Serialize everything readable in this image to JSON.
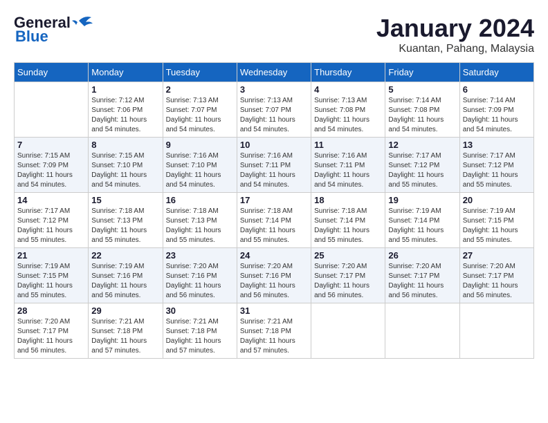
{
  "header": {
    "logo_general": "General",
    "logo_blue": "Blue",
    "month": "January 2024",
    "location": "Kuantan, Pahang, Malaysia"
  },
  "weekdays": [
    "Sunday",
    "Monday",
    "Tuesday",
    "Wednesday",
    "Thursday",
    "Friday",
    "Saturday"
  ],
  "weeks": [
    [
      {
        "day": "",
        "sunrise": "",
        "sunset": "",
        "daylight": ""
      },
      {
        "day": "1",
        "sunrise": "Sunrise: 7:12 AM",
        "sunset": "Sunset: 7:06 PM",
        "daylight": "Daylight: 11 hours and 54 minutes."
      },
      {
        "day": "2",
        "sunrise": "Sunrise: 7:13 AM",
        "sunset": "Sunset: 7:07 PM",
        "daylight": "Daylight: 11 hours and 54 minutes."
      },
      {
        "day": "3",
        "sunrise": "Sunrise: 7:13 AM",
        "sunset": "Sunset: 7:07 PM",
        "daylight": "Daylight: 11 hours and 54 minutes."
      },
      {
        "day": "4",
        "sunrise": "Sunrise: 7:13 AM",
        "sunset": "Sunset: 7:08 PM",
        "daylight": "Daylight: 11 hours and 54 minutes."
      },
      {
        "day": "5",
        "sunrise": "Sunrise: 7:14 AM",
        "sunset": "Sunset: 7:08 PM",
        "daylight": "Daylight: 11 hours and 54 minutes."
      },
      {
        "day": "6",
        "sunrise": "Sunrise: 7:14 AM",
        "sunset": "Sunset: 7:09 PM",
        "daylight": "Daylight: 11 hours and 54 minutes."
      }
    ],
    [
      {
        "day": "7",
        "sunrise": "Sunrise: 7:15 AM",
        "sunset": "Sunset: 7:09 PM",
        "daylight": "Daylight: 11 hours and 54 minutes."
      },
      {
        "day": "8",
        "sunrise": "Sunrise: 7:15 AM",
        "sunset": "Sunset: 7:10 PM",
        "daylight": "Daylight: 11 hours and 54 minutes."
      },
      {
        "day": "9",
        "sunrise": "Sunrise: 7:16 AM",
        "sunset": "Sunset: 7:10 PM",
        "daylight": "Daylight: 11 hours and 54 minutes."
      },
      {
        "day": "10",
        "sunrise": "Sunrise: 7:16 AM",
        "sunset": "Sunset: 7:11 PM",
        "daylight": "Daylight: 11 hours and 54 minutes."
      },
      {
        "day": "11",
        "sunrise": "Sunrise: 7:16 AM",
        "sunset": "Sunset: 7:11 PM",
        "daylight": "Daylight: 11 hours and 54 minutes."
      },
      {
        "day": "12",
        "sunrise": "Sunrise: 7:17 AM",
        "sunset": "Sunset: 7:12 PM",
        "daylight": "Daylight: 11 hours and 55 minutes."
      },
      {
        "day": "13",
        "sunrise": "Sunrise: 7:17 AM",
        "sunset": "Sunset: 7:12 PM",
        "daylight": "Daylight: 11 hours and 55 minutes."
      }
    ],
    [
      {
        "day": "14",
        "sunrise": "Sunrise: 7:17 AM",
        "sunset": "Sunset: 7:12 PM",
        "daylight": "Daylight: 11 hours and 55 minutes."
      },
      {
        "day": "15",
        "sunrise": "Sunrise: 7:18 AM",
        "sunset": "Sunset: 7:13 PM",
        "daylight": "Daylight: 11 hours and 55 minutes."
      },
      {
        "day": "16",
        "sunrise": "Sunrise: 7:18 AM",
        "sunset": "Sunset: 7:13 PM",
        "daylight": "Daylight: 11 hours and 55 minutes."
      },
      {
        "day": "17",
        "sunrise": "Sunrise: 7:18 AM",
        "sunset": "Sunset: 7:14 PM",
        "daylight": "Daylight: 11 hours and 55 minutes."
      },
      {
        "day": "18",
        "sunrise": "Sunrise: 7:18 AM",
        "sunset": "Sunset: 7:14 PM",
        "daylight": "Daylight: 11 hours and 55 minutes."
      },
      {
        "day": "19",
        "sunrise": "Sunrise: 7:19 AM",
        "sunset": "Sunset: 7:14 PM",
        "daylight": "Daylight: 11 hours and 55 minutes."
      },
      {
        "day": "20",
        "sunrise": "Sunrise: 7:19 AM",
        "sunset": "Sunset: 7:15 PM",
        "daylight": "Daylight: 11 hours and 55 minutes."
      }
    ],
    [
      {
        "day": "21",
        "sunrise": "Sunrise: 7:19 AM",
        "sunset": "Sunset: 7:15 PM",
        "daylight": "Daylight: 11 hours and 55 minutes."
      },
      {
        "day": "22",
        "sunrise": "Sunrise: 7:19 AM",
        "sunset": "Sunset: 7:16 PM",
        "daylight": "Daylight: 11 hours and 56 minutes."
      },
      {
        "day": "23",
        "sunrise": "Sunrise: 7:20 AM",
        "sunset": "Sunset: 7:16 PM",
        "daylight": "Daylight: 11 hours and 56 minutes."
      },
      {
        "day": "24",
        "sunrise": "Sunrise: 7:20 AM",
        "sunset": "Sunset: 7:16 PM",
        "daylight": "Daylight: 11 hours and 56 minutes."
      },
      {
        "day": "25",
        "sunrise": "Sunrise: 7:20 AM",
        "sunset": "Sunset: 7:17 PM",
        "daylight": "Daylight: 11 hours and 56 minutes."
      },
      {
        "day": "26",
        "sunrise": "Sunrise: 7:20 AM",
        "sunset": "Sunset: 7:17 PM",
        "daylight": "Daylight: 11 hours and 56 minutes."
      },
      {
        "day": "27",
        "sunrise": "Sunrise: 7:20 AM",
        "sunset": "Sunset: 7:17 PM",
        "daylight": "Daylight: 11 hours and 56 minutes."
      }
    ],
    [
      {
        "day": "28",
        "sunrise": "Sunrise: 7:20 AM",
        "sunset": "Sunset: 7:17 PM",
        "daylight": "Daylight: 11 hours and 56 minutes."
      },
      {
        "day": "29",
        "sunrise": "Sunrise: 7:21 AM",
        "sunset": "Sunset: 7:18 PM",
        "daylight": "Daylight: 11 hours and 57 minutes."
      },
      {
        "day": "30",
        "sunrise": "Sunrise: 7:21 AM",
        "sunset": "Sunset: 7:18 PM",
        "daylight": "Daylight: 11 hours and 57 minutes."
      },
      {
        "day": "31",
        "sunrise": "Sunrise: 7:21 AM",
        "sunset": "Sunset: 7:18 PM",
        "daylight": "Daylight: 11 hours and 57 minutes."
      },
      {
        "day": "",
        "sunrise": "",
        "sunset": "",
        "daylight": ""
      },
      {
        "day": "",
        "sunrise": "",
        "sunset": "",
        "daylight": ""
      },
      {
        "day": "",
        "sunrise": "",
        "sunset": "",
        "daylight": ""
      }
    ]
  ]
}
